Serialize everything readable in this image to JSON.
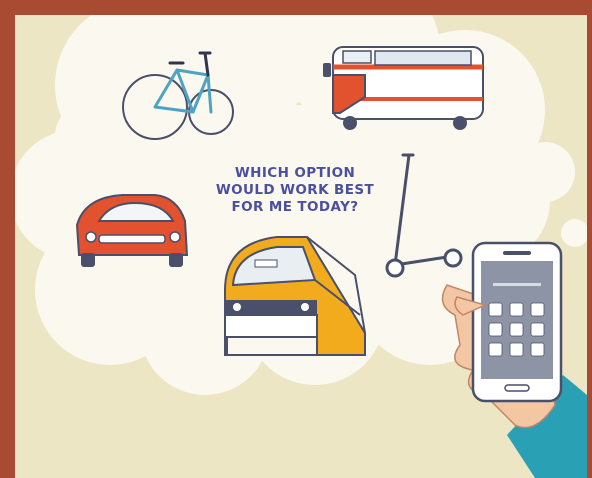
{
  "illustration": {
    "question_lines": [
      "WHICH OPTION",
      "WOULD WORK BEST",
      "FOR ME TODAY?"
    ],
    "icons": [
      "bicycle-icon",
      "bus-icon",
      "car-icon",
      "scooter-icon",
      "train-icon",
      "phone-app-icon"
    ],
    "colors": {
      "frame": "#a94a33",
      "background": "#ece6c5",
      "cloud": "#fbf9ef",
      "text": "#4a4fa0",
      "vehicle_orange": "#e2522e",
      "train_yellow": "#f2ab1d",
      "bike_blue": "#4da3c4",
      "sleeve_teal": "#2aa0b5"
    }
  }
}
